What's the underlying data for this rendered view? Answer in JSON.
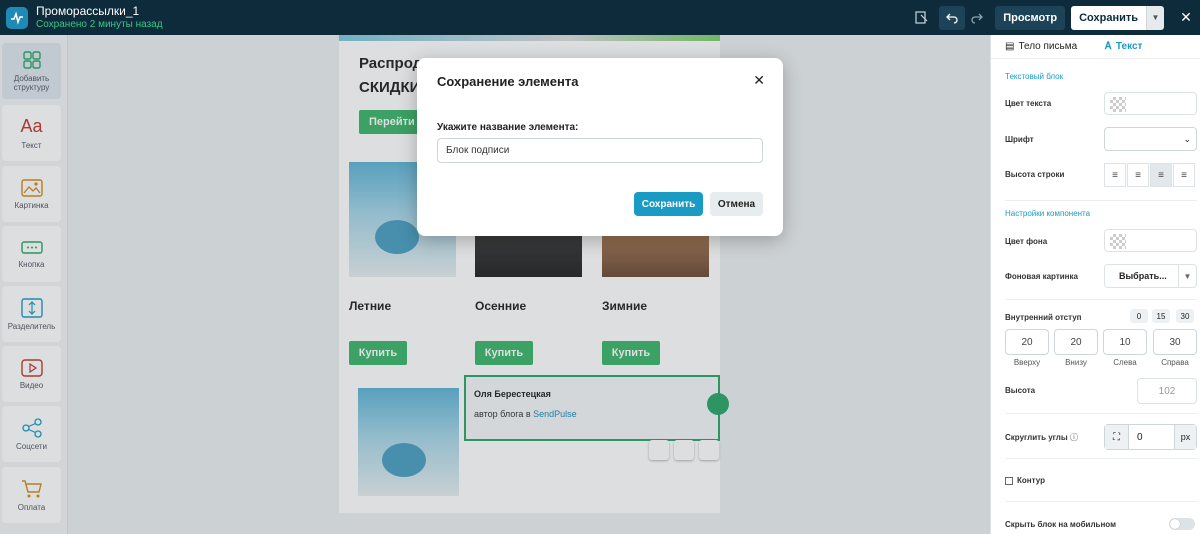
{
  "app": {
    "title": "Проморассылки_1",
    "saved_status": "Сохранено 2 минуты назад"
  },
  "toolbar": {
    "preview_label": "Просмотр",
    "save_label": "Сохранить"
  },
  "sidebar": {
    "items": [
      {
        "label": "Добавить структуру",
        "icon": "grid-icon"
      },
      {
        "label": "Текст",
        "icon": "text-icon"
      },
      {
        "label": "Картинка",
        "icon": "image-icon"
      },
      {
        "label": "Кнопка",
        "icon": "button-icon"
      },
      {
        "label": "Разделитель",
        "icon": "divider-icon"
      },
      {
        "label": "Видео",
        "icon": "video-icon"
      },
      {
        "label": "Соцсети",
        "icon": "share-icon"
      },
      {
        "label": "Оплата",
        "icon": "cart-icon"
      }
    ]
  },
  "email": {
    "heading_line1": "Распрод",
    "heading_line2": "СКИДКИ",
    "go_button": "Перейти к",
    "products": [
      {
        "name": "Летние",
        "buy": "Купить"
      },
      {
        "name": "Осенние",
        "buy": "Купить"
      },
      {
        "name": "Зимние",
        "buy": "Купить"
      }
    ],
    "signature": {
      "name": "Оля Берестецкая",
      "desc_prefix": "автор блога в ",
      "link": "SendPulse"
    }
  },
  "modal": {
    "title": "Сохранение элемента",
    "field_label": "Укажите название элемента:",
    "field_value": "Блок подписи",
    "save_label": "Сохранить",
    "cancel_label": "Отмена"
  },
  "right_panel": {
    "tabs": [
      "Тело письма",
      "Текст"
    ],
    "section_text": "Текстовый блок",
    "text_color_label": "Цвет текста",
    "font_label": "Шрифт",
    "line_height_label": "Высота строки",
    "section_component": "Настройки компонента",
    "bg_color_label": "Цвет фона",
    "bg_image_label": "Фоновая картинка",
    "choose_label": "Выбрать...",
    "padding_label": "Внутренний отступ",
    "padding_quick": [
      "0",
      "15",
      "30"
    ],
    "padding": [
      {
        "value": "20",
        "label": "Вверху"
      },
      {
        "value": "20",
        "label": "Внизу"
      },
      {
        "value": "10",
        "label": "Слева"
      },
      {
        "value": "30",
        "label": "Справа"
      }
    ],
    "height_label": "Высота",
    "height_value": "102",
    "round_label": "Скруглить углы",
    "round_value": "0",
    "round_unit": "px",
    "outline_label": "Контур",
    "hide_mobile_label": "Скрыть блок на мобильном"
  },
  "colors": {
    "topbar": "#0d2b3a",
    "accent": "#1a9bc4",
    "green": "#3bb56a"
  }
}
